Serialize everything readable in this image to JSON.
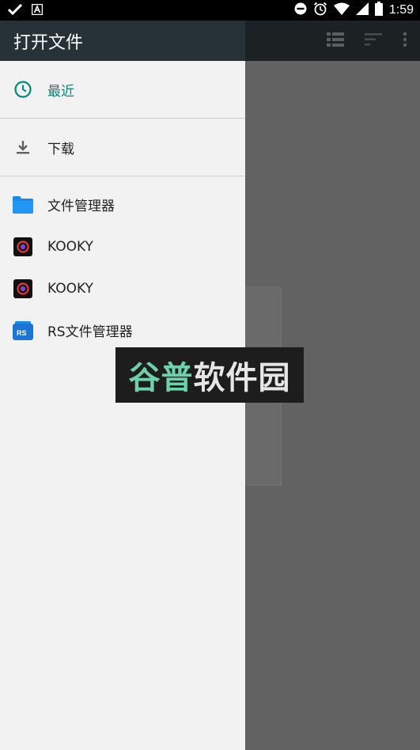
{
  "status_bar": {
    "time": "1:59",
    "left_icons": [
      "check-icon",
      "app-a-icon"
    ],
    "right_icons": [
      "do-not-disturb-icon",
      "alarm-icon",
      "wifi-icon",
      "signal-icon",
      "battery-icon"
    ]
  },
  "drawer": {
    "title": "打开文件",
    "items": [
      {
        "label": "最近",
        "icon": "clock-icon",
        "active": true
      },
      {
        "label": "下载",
        "icon": "download-icon"
      },
      {
        "label": "文件管理器",
        "icon": "folder-icon"
      },
      {
        "label": "KOOKY",
        "icon": "kooky-app-icon"
      },
      {
        "label": "KOOKY",
        "icon": "kooky-app-icon"
      },
      {
        "label": "RS文件管理器",
        "icon": "rs-file-manager-icon"
      }
    ]
  },
  "toolbar": {
    "actions": [
      "list-view-icon",
      "sort-icon",
      "more-vert-icon"
    ]
  },
  "watermark": {
    "part1": "谷普",
    "part2": "软件园"
  },
  "colors": {
    "accent": "#00897b",
    "header": "#263238",
    "drawer_bg": "#f2f2f2",
    "scrim": "#616161"
  }
}
